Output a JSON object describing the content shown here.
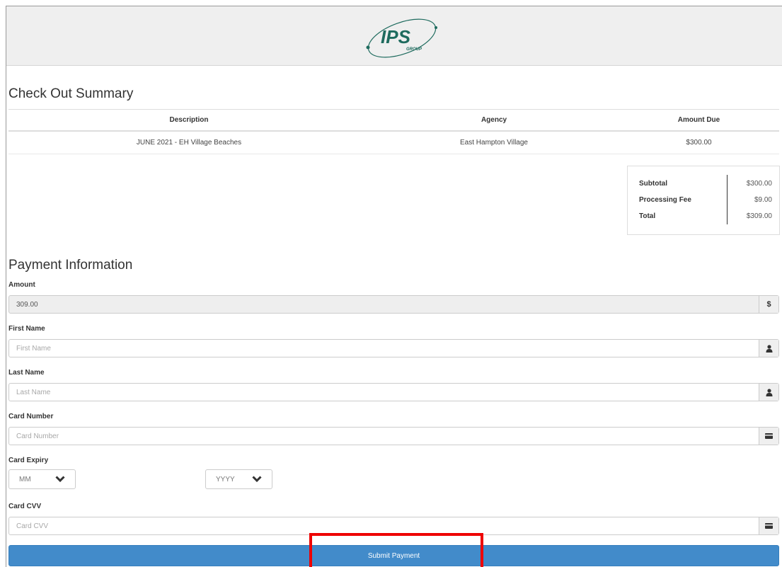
{
  "colors": {
    "accent": "#428bca",
    "header_bg": "#efefef",
    "highlight": "#ee0000",
    "logo_green": "#1e6b5e"
  },
  "header": {
    "logo_text": "IPS",
    "logo_subtext": "GROUP"
  },
  "checkout": {
    "title": "Check Out Summary",
    "columns": [
      "Description",
      "Agency",
      "Amount Due"
    ],
    "rows": [
      {
        "description": "JUNE 2021 - EH Village Beaches",
        "agency": "East Hampton Village",
        "amount": "$300.00"
      }
    ],
    "summary": {
      "subtotal_label": "Subtotal",
      "subtotal": "$300.00",
      "fee_label": "Processing Fee",
      "fee": "$9.00",
      "total_label": "Total",
      "total": "$309.00"
    }
  },
  "payment": {
    "title": "Payment Information",
    "amount": {
      "label": "Amount",
      "value": "309.00",
      "addon": "$"
    },
    "first_name": {
      "label": "First Name",
      "placeholder": "First Name",
      "icon": "user-icon"
    },
    "last_name": {
      "label": "Last Name",
      "placeholder": "Last Name",
      "icon": "user-icon"
    },
    "card_number": {
      "label": "Card Number",
      "placeholder": "Card Number",
      "icon": "credit-card-icon"
    },
    "card_expiry": {
      "label": "Card Expiry",
      "month": "MM",
      "year": "YYYY"
    },
    "card_cvv": {
      "label": "Card CVV",
      "placeholder": "Card CVV",
      "icon": "credit-card-icon"
    },
    "submit_label": "Submit Payment"
  }
}
